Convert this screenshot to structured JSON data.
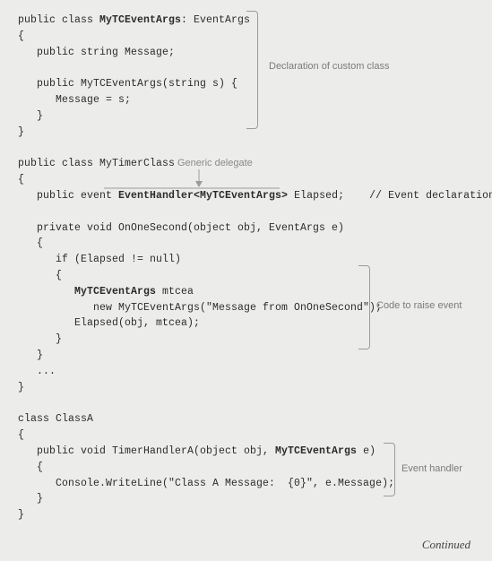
{
  "code": {
    "l01a": "public class ",
    "l01b": "MyTCEventArgs",
    "l01c": ": EventArgs",
    "l02": "{",
    "l03": "   public string Message;",
    "l04": "",
    "l05": "   public MyTCEventArgs(string s) {",
    "l06": "      Message = s;",
    "l07": "   }",
    "l08": "}",
    "l09": "",
    "l10": "public class MyTimerClass",
    "l11": "{",
    "l12a": "   public event ",
    "l12b": "EventHandler<MyTCEventArgs>",
    "l12c": " Elapsed;",
    "l12d": "// Event declaration",
    "l13": "",
    "l14": "   private void OnOneSecond(object obj, EventArgs e)",
    "l15": "   {",
    "l16": "      if (Elapsed != null)",
    "l17": "      {",
    "l18a": "         ",
    "l18b": "MyTCEventArgs",
    "l18c": " mtcea",
    "l19": "            new MyTCEventArgs(\"Message from OnOneSecond\");",
    "l20": "         Elapsed(obj, mtcea);",
    "l21": "      }",
    "l22": "   }",
    "l23": "   ...",
    "l24": "}",
    "l25": "",
    "l26": "class ClassA",
    "l27": "{",
    "l28a": "   public void TimerHandlerA(object obj, ",
    "l28b": "MyTCEventArgs",
    "l28c": " e)",
    "l29": "   {",
    "l30": "      Console.WriteLine(\"Class A Message:  {0}\", e.Message);",
    "l31": "   }",
    "l32": "}"
  },
  "ann": {
    "custom_class": "Declaration of custom class",
    "generic_delegate": "Generic delegate",
    "raise_event": "Code to raise event",
    "event_handler": "Event handler",
    "continued": "Continued"
  }
}
